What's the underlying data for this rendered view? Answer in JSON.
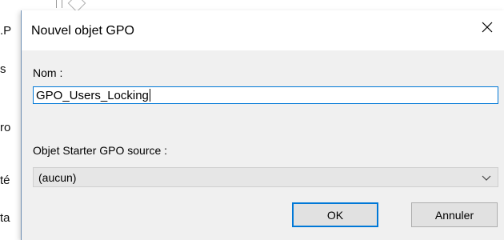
{
  "background": {
    "fragments": [
      ".P",
      "s",
      "ro",
      "té",
      "ta"
    ]
  },
  "dialog": {
    "title": "Nouvel objet GPO",
    "close_icon": "close-icon",
    "name_label": "Nom :",
    "name_value": "GPO_Users_Locking",
    "starter_label": "Objet Starter GPO source :",
    "starter_selected": "(aucun)",
    "ok_label": "OK",
    "cancel_label": "Annuler"
  },
  "colors": {
    "accent": "#0078d7",
    "dialog_bg": "#f0f0f0",
    "combo_bg": "#e6e6e6",
    "button_bg": "#e1e1e1"
  }
}
